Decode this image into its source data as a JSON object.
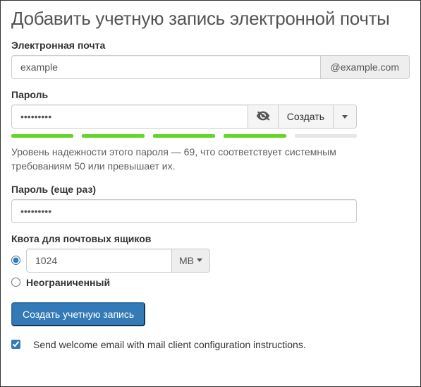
{
  "heading": "Добавить учетную запись электронной почты",
  "email": {
    "label": "Электронная почта",
    "value": "example",
    "domain": "@example.com"
  },
  "password": {
    "label": "Пароль",
    "value": "•••••••••",
    "generate_label": "Создать",
    "strength_segments": 5,
    "strength_filled": 4,
    "help": "Уровень надежности этого пароля — 69, что соответствует системным требованиям 50 или превышает их."
  },
  "password_confirm": {
    "label": "Пароль (еще раз)",
    "value": "•••••••••"
  },
  "quota": {
    "label": "Квота для почтовых ящиков",
    "value": "1024",
    "unit": "MB",
    "unlimited_label": "Неограниченный",
    "selected": "value"
  },
  "submit_label": "Создать учетную запись",
  "welcome": {
    "label": "Send welcome email with mail client configuration instructions.",
    "checked": true
  }
}
